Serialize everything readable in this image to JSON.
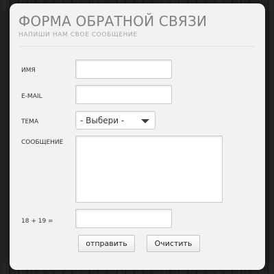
{
  "form": {
    "title": "ФОРМА ОБРАТНОЙ СВЯЗИ",
    "subtitle": "НАПИШИ НАМ СВОЕ СООБЩЕНИЕ",
    "fields": {
      "name": {
        "label": "ИМЯ",
        "value": ""
      },
      "email": {
        "label": "E-MAIL",
        "value": ""
      },
      "topic": {
        "label": "ТЕМА",
        "selected": "- Выбери -"
      },
      "message": {
        "label": "СООБЩЕНИЕ",
        "value": ""
      },
      "captcha": {
        "label": "18 + 19 =",
        "value": ""
      }
    },
    "buttons": {
      "submit": "отправить",
      "clear": "Очистить"
    }
  }
}
